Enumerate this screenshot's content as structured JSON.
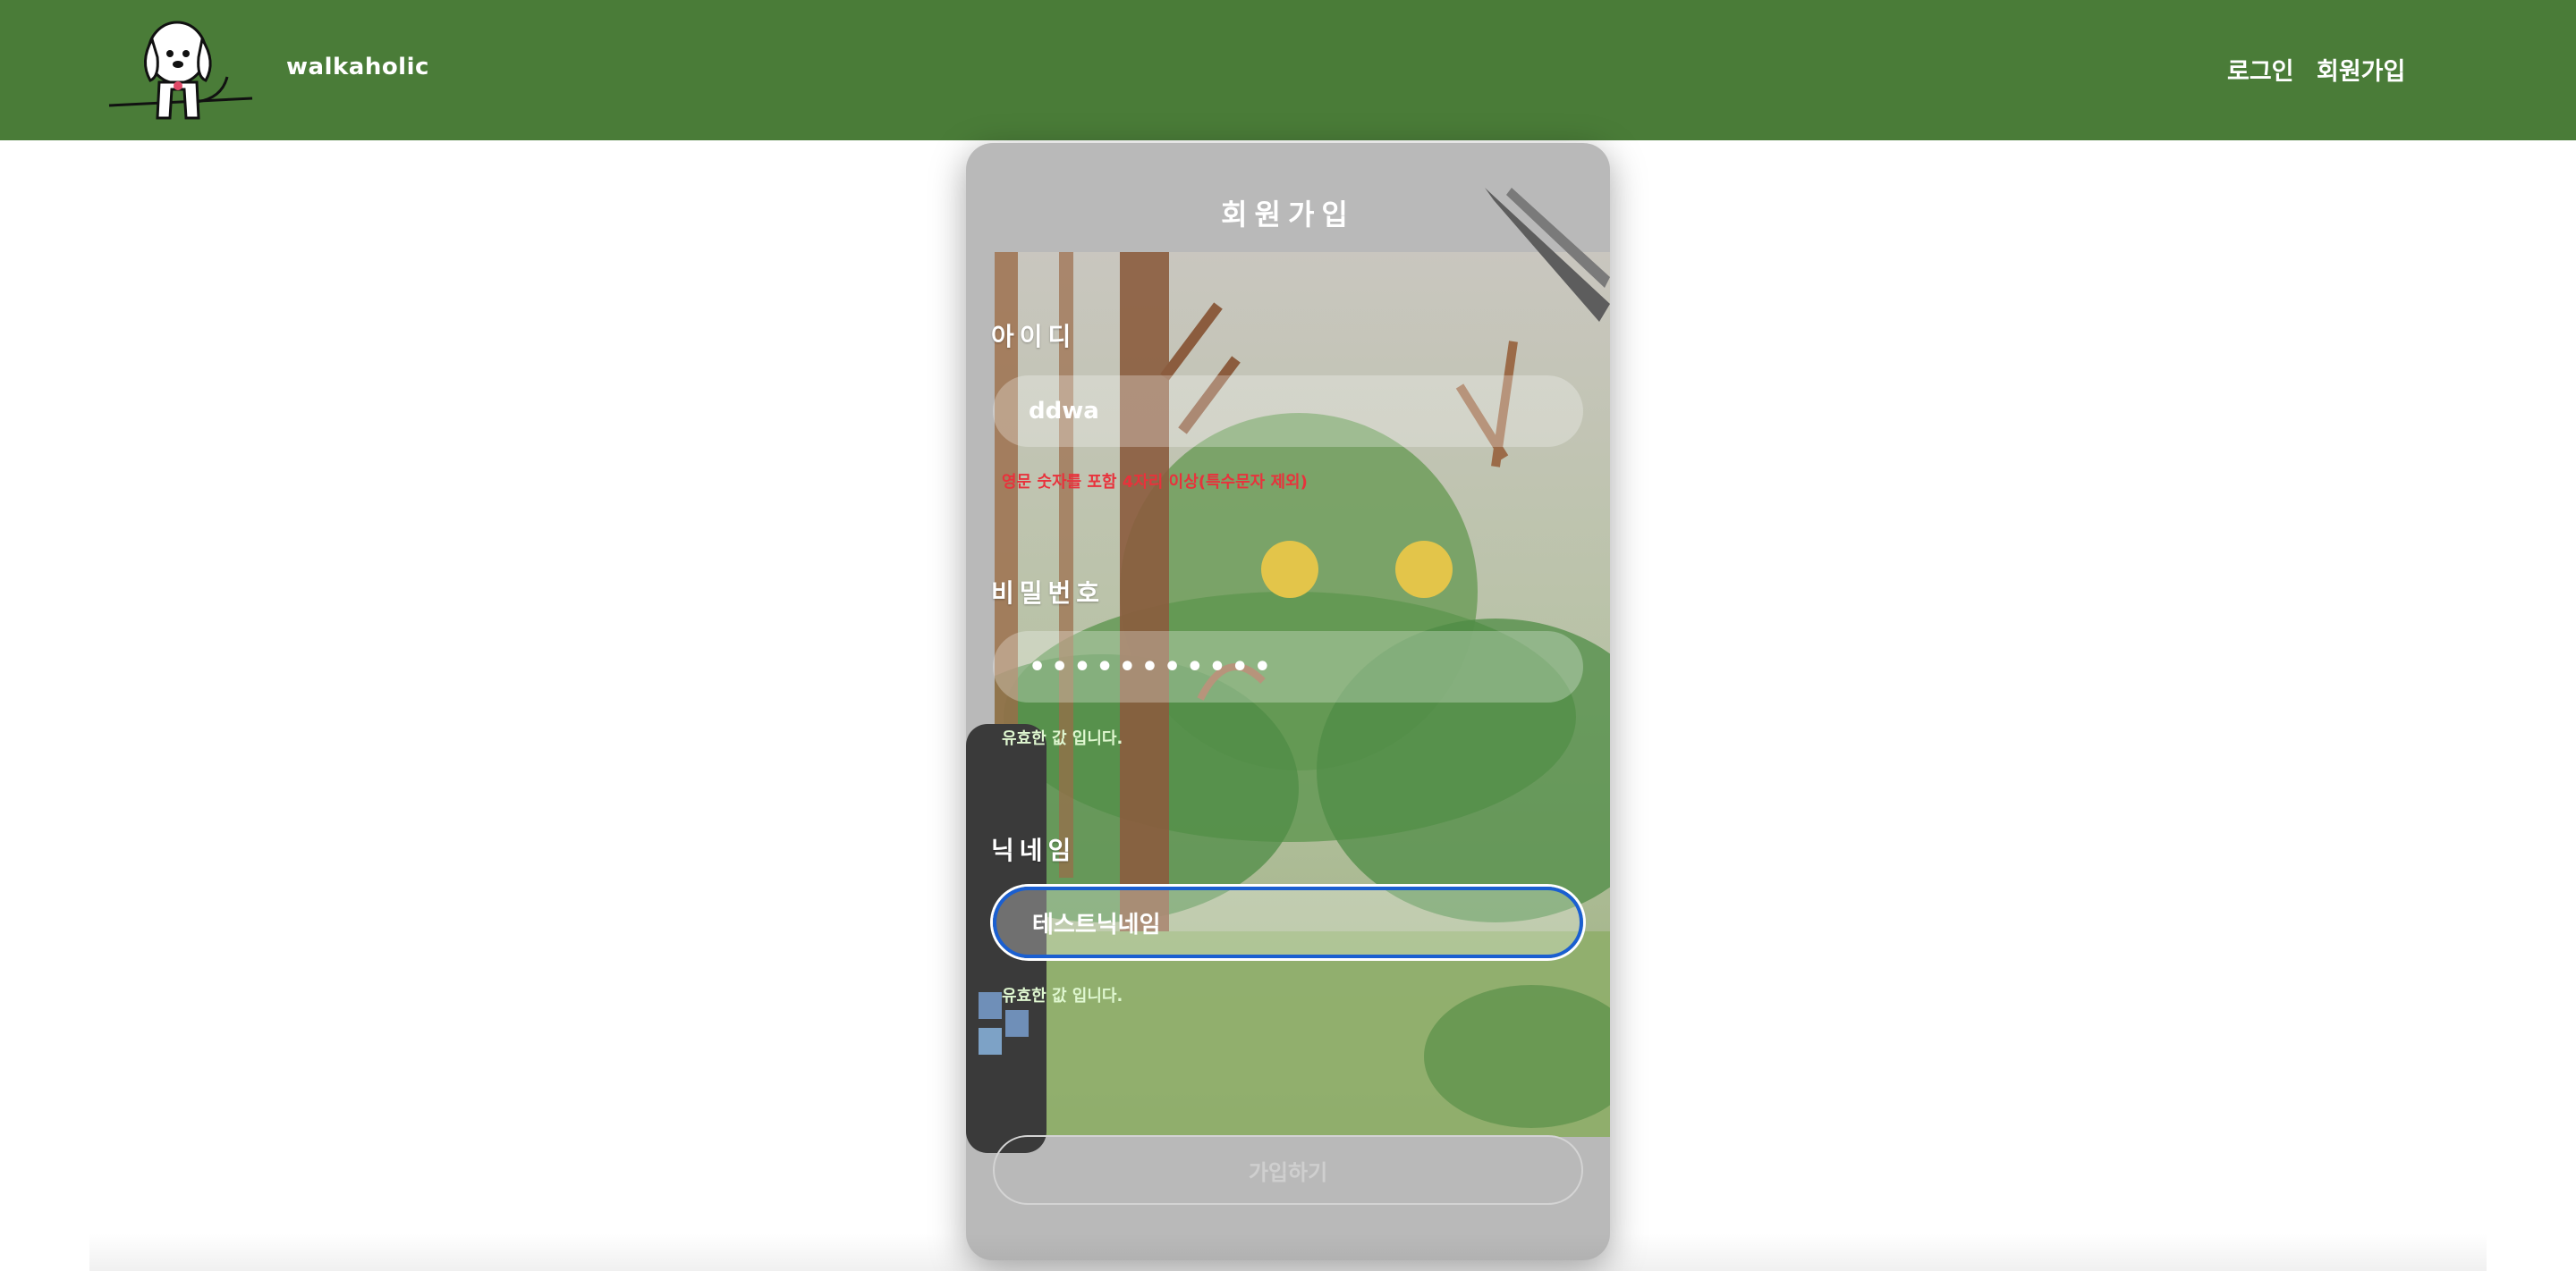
{
  "header": {
    "brand": "walkaholic",
    "nav": {
      "login": "로그인",
      "signup": "회원가입"
    },
    "bg_color": "#4a7c38"
  },
  "form": {
    "title": "회원가입",
    "id_field": {
      "label": "아이디",
      "value": "ddwa",
      "message": "영문 숫자를 포함 4자리 이상(특수문자 제외)",
      "message_status": "error"
    },
    "password_field": {
      "label": "비밀번호",
      "value": "•••••••••••",
      "message": "유효한 값 입니다.",
      "message_status": "valid"
    },
    "nickname_field": {
      "label": "닉네임",
      "value": "테스트닉네임",
      "message": "유효한 값 입니다.",
      "message_status": "valid",
      "focused": true
    },
    "submit_label": "가입하기"
  },
  "colors": {
    "error": "#e8323c",
    "valid": "#dff7d0",
    "focus_ring": "#1a5fd1"
  }
}
